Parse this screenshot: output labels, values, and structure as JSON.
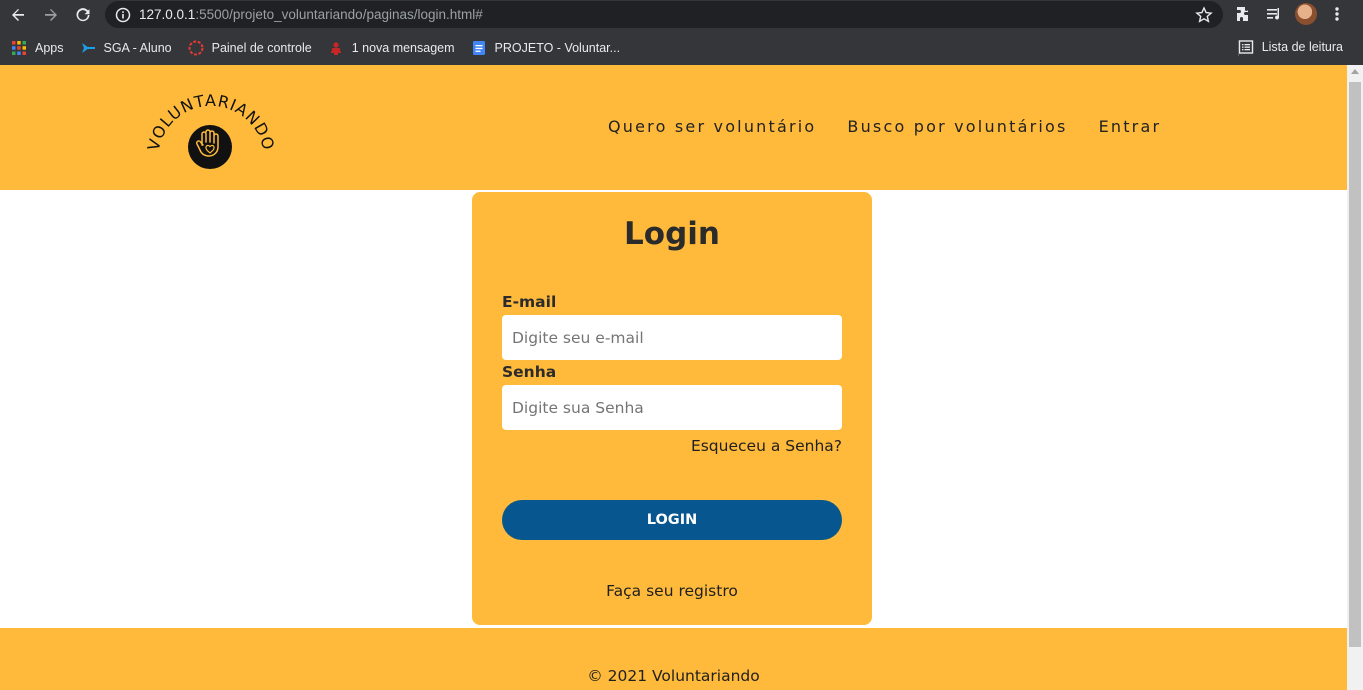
{
  "browser": {
    "url_host": "127.0.0.1",
    "url_rest": ":5500/projeto_voluntariando/paginas/login.html#",
    "bookmarks": [
      {
        "label": "Apps",
        "icon": "apps-grid-icon"
      },
      {
        "label": "SGA - Aluno",
        "icon": "sga-icon"
      },
      {
        "label": "Painel de controle",
        "icon": "dashboard-icon"
      },
      {
        "label": "1 nova mensagem",
        "icon": "mail-icon"
      },
      {
        "label": "PROJETO - Voluntar...",
        "icon": "doc-icon"
      }
    ],
    "reading_list": "Lista de leitura"
  },
  "header": {
    "logo_text": "VOLUNTARIANDO",
    "nav": [
      "Quero ser voluntário",
      "Busco por voluntários",
      "Entrar"
    ]
  },
  "login": {
    "title": "Login",
    "email_label": "E-mail",
    "email_placeholder": "Digite seu e-mail",
    "password_label": "Senha",
    "password_placeholder": "Digite sua Senha",
    "forgot": "Esqueceu a Senha?",
    "button": "LOGIN",
    "register": "Faça seu registro"
  },
  "footer": {
    "copyright": "© 2021 Voluntariando"
  },
  "colors": {
    "brand_yellow": "#ffba3b",
    "button_blue": "#07568f"
  }
}
